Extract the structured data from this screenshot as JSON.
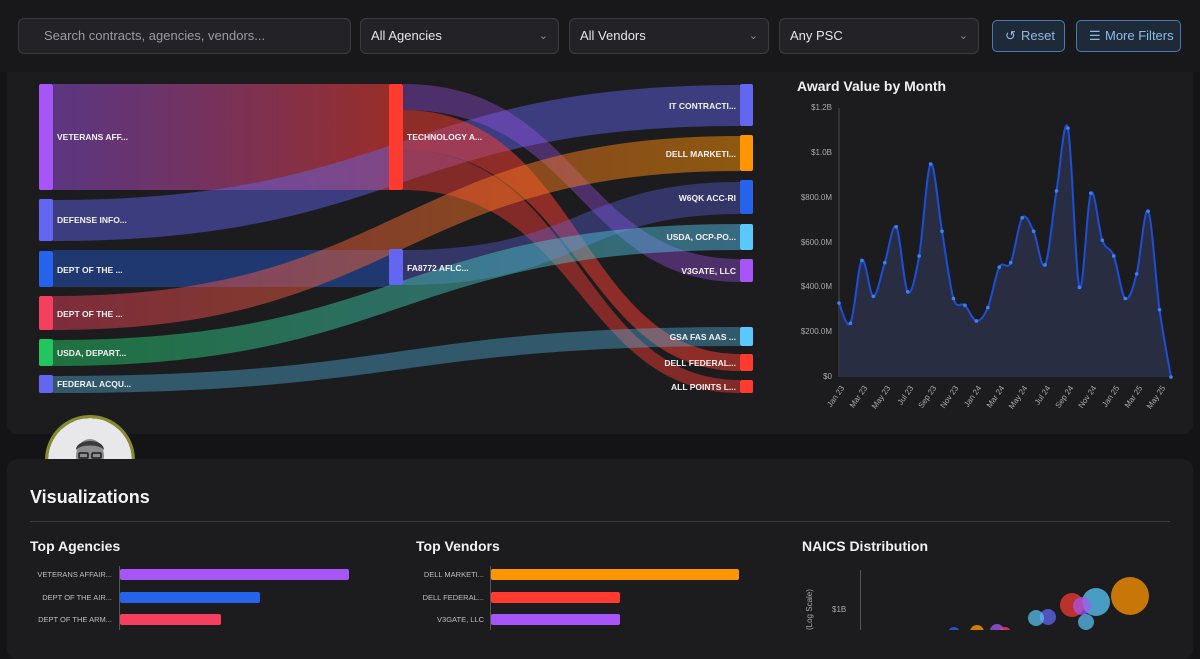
{
  "filters": {
    "search_placeholder": "Search contracts, agencies, vendors...",
    "agency": "All Agencies",
    "vendor": "All Vendors",
    "psc": "Any PSC",
    "reset_label": "Reset",
    "more_label": "More Filters"
  },
  "sankey": {
    "sources": [
      "VETERANS AFF...",
      "DEFENSE INFO...",
      "DEPT OF THE ...",
      "DEPT OF THE ...",
      "USDA, DEPART...",
      "FEDERAL ACQU..."
    ],
    "middle": [
      "TECHNOLOGY A...",
      "FA8772 AFLC..."
    ],
    "targets": [
      "IT CONTRACTI...",
      "DELL MARKETI...",
      "W6QK ACC-RI",
      "USDA, OCP-PO...",
      "V3GATE, LLC",
      "GSA FAS AAS ...",
      "DELL FEDERAL...",
      "ALL POINTS L..."
    ]
  },
  "month_chart": {
    "title": "Award Value by Month",
    "y_ticks": [
      "$1.2B",
      "$1.0B",
      "$800.0M",
      "$600.0M",
      "$400.0M",
      "$200.0M",
      "$0"
    ],
    "x_ticks": [
      "Jan 23",
      "Mar 23",
      "May 23",
      "Jul 23",
      "Sep 23",
      "Nov 23",
      "Jan 24",
      "Mar 24",
      "May 24",
      "Jul 24",
      "Sep 24",
      "Nov 24",
      "Jan 25",
      "Mar 25",
      "May 25"
    ]
  },
  "chart_data": {
    "type": "area",
    "title": "Award Value by Month",
    "ylim": [
      0,
      1200
    ],
    "y_unit": "$M",
    "x": [
      "Jan 23",
      "Feb 23",
      "Mar 23",
      "Apr 23",
      "May 23",
      "Jun 23",
      "Jul 23",
      "Aug 23",
      "Sep 23",
      "Oct 23",
      "Nov 23",
      "Dec 23",
      "Jan 24",
      "Feb 24",
      "Mar 24",
      "Apr 24",
      "May 24",
      "Jun 24",
      "Jul 24",
      "Aug 24",
      "Sep 24",
      "Oct 24",
      "Nov 24",
      "Dec 24",
      "Jan 25",
      "Feb 25",
      "Mar 25",
      "Apr 25",
      "May 25",
      "Jun 25"
    ],
    "values": [
      330,
      240,
      520,
      360,
      510,
      670,
      380,
      540,
      950,
      650,
      350,
      320,
      250,
      310,
      490,
      510,
      710,
      650,
      500,
      830,
      1110,
      400,
      820,
      610,
      540,
      350,
      460,
      740,
      300,
      0
    ]
  },
  "visualizations": {
    "title": "Visualizations",
    "top_agencies": {
      "title": "Top Agencies",
      "labels": [
        "VETERANS AFFAIR...",
        "DEPT OF THE AIR...",
        "DEPT OF THE ARM..."
      ],
      "values": [
        1.0,
        0.61,
        0.44
      ],
      "colors": [
        "#a855f7",
        "#2563eb",
        "#f43f5e"
      ]
    },
    "top_vendors": {
      "title": "Top Vendors",
      "labels": [
        "DELL MARKETI...",
        "DELL FEDERAL...",
        "V3GATE, LLC"
      ],
      "values": [
        1.0,
        0.52,
        0.52
      ],
      "colors": [
        "#ff9500",
        "#ff3b30",
        "#a855f7"
      ]
    },
    "naics": {
      "title": "NAICS Distribution",
      "y_label": "(Log Scale)",
      "y_tick": "$1B"
    }
  },
  "colors": {
    "veterans": "#a855f7",
    "defense": "#6366f1",
    "dept_blue": "#2563eb",
    "dept_red": "#f43f5e",
    "usda": "#22c55e",
    "federal": "#6366f1",
    "technology": "#ff3b30",
    "fa8772": "#6366f1",
    "it_contract": "#6366f1",
    "dell_marketing": "#ff9500",
    "w6qk": "#2563eb",
    "usda_ocp": "#5ac8fa",
    "v3gate": "#a855f7",
    "gsa": "#5ac8fa",
    "dell_federal": "#ff3b30",
    "all_points": "#ff3b30"
  }
}
